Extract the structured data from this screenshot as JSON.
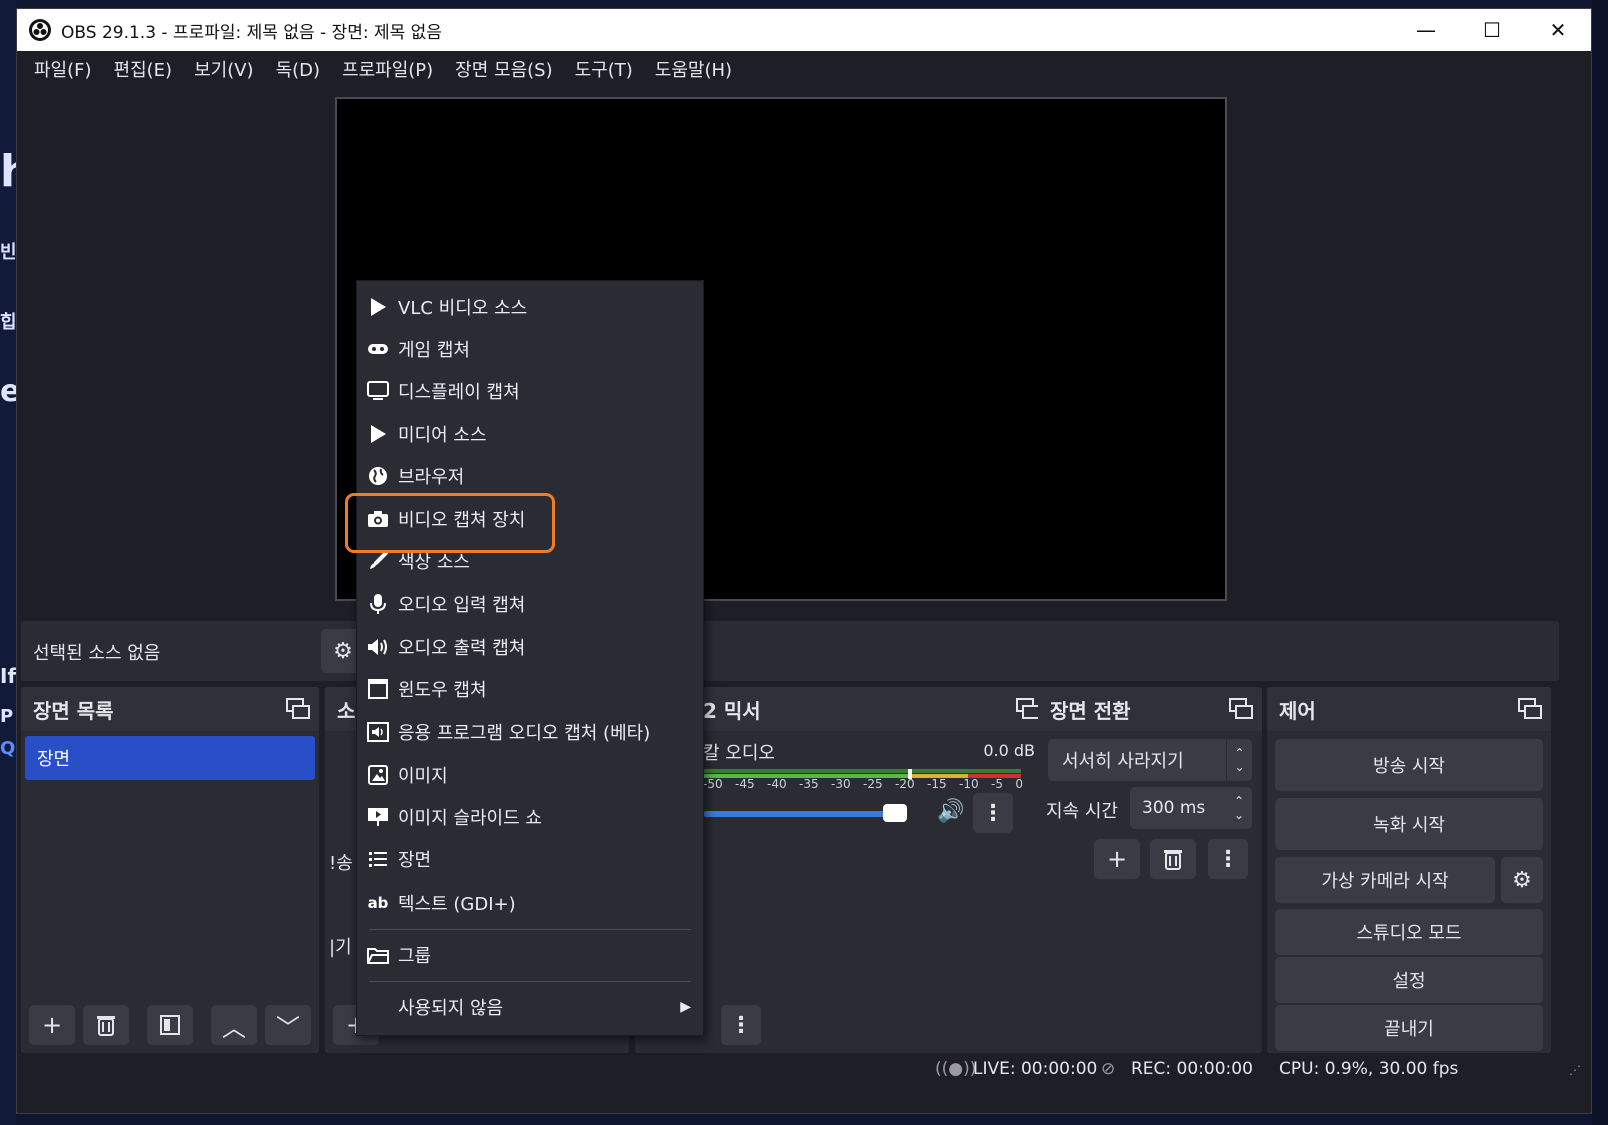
{
  "app": {
    "title": "OBS 29.1.3 - 프로파일: 제목 없음 - 장면: 제목 없음",
    "minimize": "—",
    "maximize": "☐",
    "close": "✕"
  },
  "menubar": [
    "파일(F)",
    "편집(E)",
    "보기(V)",
    "독(D)",
    "프로파일(P)",
    "장면 모음(S)",
    "도구(T)",
    "도움말(H)"
  ],
  "source_toolbar": {
    "no_source": "선택된 소스 없음"
  },
  "scenes": {
    "title": "장면 목록",
    "items": [
      "장면"
    ]
  },
  "sources": {
    "title_fragment": "소",
    "partial_texts": [
      "!송",
      "|기"
    ]
  },
  "mixer": {
    "title_fragment": "2 믹서",
    "track_label_fragment": "칼 오디오",
    "db_value": "0.0 dB",
    "scale": [
      "-50",
      "-45",
      "-40",
      "-35",
      "-30",
      "-25",
      "-20",
      "-15",
      "-10",
      "-5",
      "0"
    ],
    "volume_level": 0.88
  },
  "transitions": {
    "title": "장면 전환",
    "selected": "서서히 사라지기",
    "duration_label": "지속 시간",
    "duration_value": "300 ms"
  },
  "controls": {
    "title": "제어",
    "buttons": [
      "방송 시작",
      "녹화 시작",
      "가상 카메라 시작",
      "스튜디오 모드",
      "설정",
      "끝내기"
    ]
  },
  "status": {
    "live": "LIVE: 00:00:00",
    "rec": "REC: 00:00:00",
    "cpu": "CPU: 0.9%, 30.00 fps"
  },
  "context_menu": {
    "items": [
      {
        "label": "VLC 비디오 소스",
        "icon": "play-icon"
      },
      {
        "label": "게임 캡쳐",
        "icon": "gamepad-icon"
      },
      {
        "label": "디스플레이 캡쳐",
        "icon": "monitor-icon"
      },
      {
        "label": "미디어 소스",
        "icon": "play-icon"
      },
      {
        "label": "브라우저",
        "icon": "globe-icon"
      },
      {
        "label": "비디오 캡쳐 장치",
        "icon": "camera-icon"
      },
      {
        "label": "색상 소스",
        "icon": "brush-icon"
      },
      {
        "label": "오디오 입력 캡쳐",
        "icon": "microphone-icon"
      },
      {
        "label": "오디오 출력 캡쳐",
        "icon": "speaker-icon"
      },
      {
        "label": "윈도우 캡쳐",
        "icon": "window-icon"
      },
      {
        "label": "응용 프로그램 오디오 캡처 (베타)",
        "icon": "app-audio-icon"
      },
      {
        "label": "이미지",
        "icon": "image-icon"
      },
      {
        "label": "이미지 슬라이드 쇼",
        "icon": "slideshow-icon"
      },
      {
        "label": "장면",
        "icon": "list-icon"
      },
      {
        "label": "텍스트 (GDI+)",
        "icon": "text-icon"
      },
      {
        "label": "그룹",
        "icon": "folder-icon"
      },
      {
        "label": "사용되지 않음",
        "icon": ""
      }
    ],
    "text_icon_glyph": "ab",
    "highlighted": "비디오 캡쳐 장치"
  },
  "background_fragments": [
    "h",
    "빈",
    "힙",
    "et",
    "If",
    "P",
    "Qu"
  ],
  "colors": {
    "accent_selected": "#284fc7",
    "highlight_outline": "#ee7d2a",
    "meter_green": "#58b947",
    "meter_yellow": "#d9b23a",
    "meter_red": "#c9303a"
  }
}
